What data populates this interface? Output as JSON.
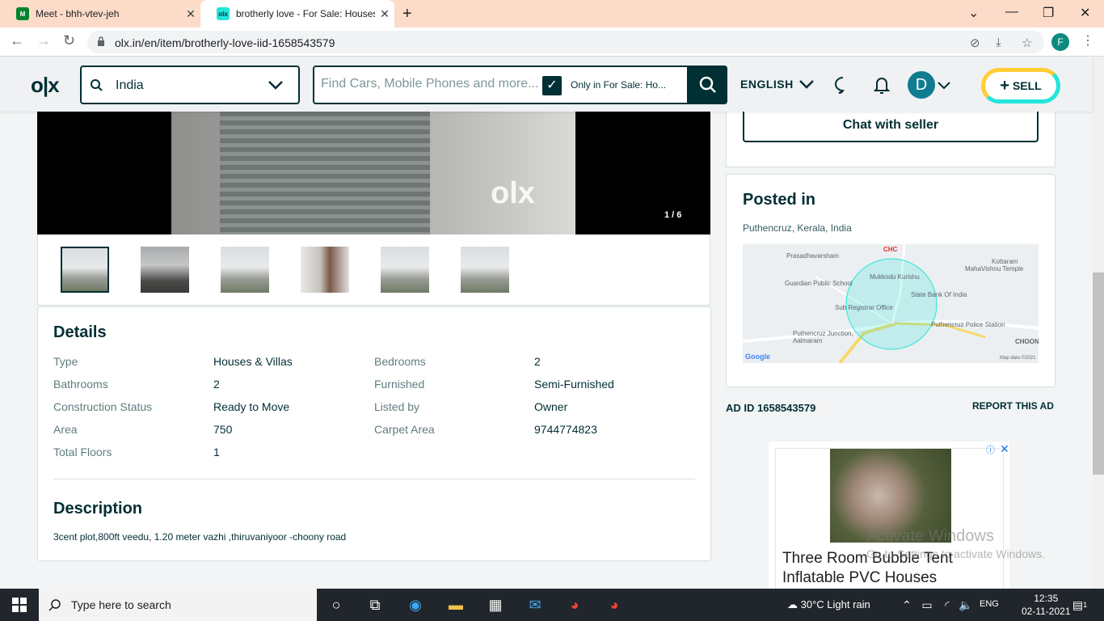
{
  "browser": {
    "tabs": [
      {
        "title": "Meet - bhh-vtev-jeh",
        "active": false
      },
      {
        "title": "brotherly love - For Sale: Houses",
        "active": true
      }
    ],
    "url": "olx.in/en/item/brotherly-love-iid-1658543579",
    "profile_initial": "F"
  },
  "header": {
    "location": "India",
    "search_placeholder": "Find Cars, Mobile Phones and more...",
    "only_in_label": "Only in For Sale: Ho...",
    "language": "ENGLISH",
    "avatar_initial": "D",
    "sell_label": "SELL"
  },
  "gallery": {
    "counter": "1 / 6",
    "watermark": "olx"
  },
  "details": {
    "heading": "Details",
    "rows": [
      {
        "label": "Type",
        "value": "Houses & Villas"
      },
      {
        "label": "Bedrooms",
        "value": "2"
      },
      {
        "label": "Bathrooms",
        "value": "2"
      },
      {
        "label": "Furnished",
        "value": "Semi-Furnished"
      },
      {
        "label": "Construction Status",
        "value": "Ready to Move"
      },
      {
        "label": "Listed by",
        "value": "Owner"
      },
      {
        "label": "Area",
        "value": "750"
      },
      {
        "label": "Carpet Area",
        "value": "9744774823"
      },
      {
        "label": "Total Floors",
        "value": "1"
      }
    ]
  },
  "description": {
    "heading": "Description",
    "text": "3cent plot,800ft veedu, 1.20 meter vazhi ,thiruvaniyoor -choony road"
  },
  "sidebar": {
    "chat_label": "Chat with seller",
    "posted_heading": "Posted in",
    "posted_location": "Puthencruz, Kerala, India",
    "map_labels": [
      "Prasadhavarsham",
      "CHC",
      "Kottaram",
      "MahaVishnu Temple",
      "Guardian Public School",
      "Mukkodu Kurishu",
      "State Bank Of India",
      "Sub Registrar Office",
      "Puthencruz Police Station",
      "Puthencruz Junction, Aalmaram",
      "CHOONDI",
      "Google",
      "Map data ©2021"
    ],
    "ad_id": "AD ID 1658543579",
    "report_label": "REPORT THIS AD"
  },
  "advert": {
    "title": "Three Room Bubble Tent Inflatable PVC Houses"
  },
  "watermark_windows": {
    "line1": "Activate Windows",
    "line2": "Go to Settings to activate Windows."
  },
  "taskbar": {
    "search_placeholder": "Type here to search",
    "weather": "30°C  Light rain",
    "language": "ENG",
    "time": "12:35",
    "date": "02-11-2021",
    "notifications": "1"
  }
}
